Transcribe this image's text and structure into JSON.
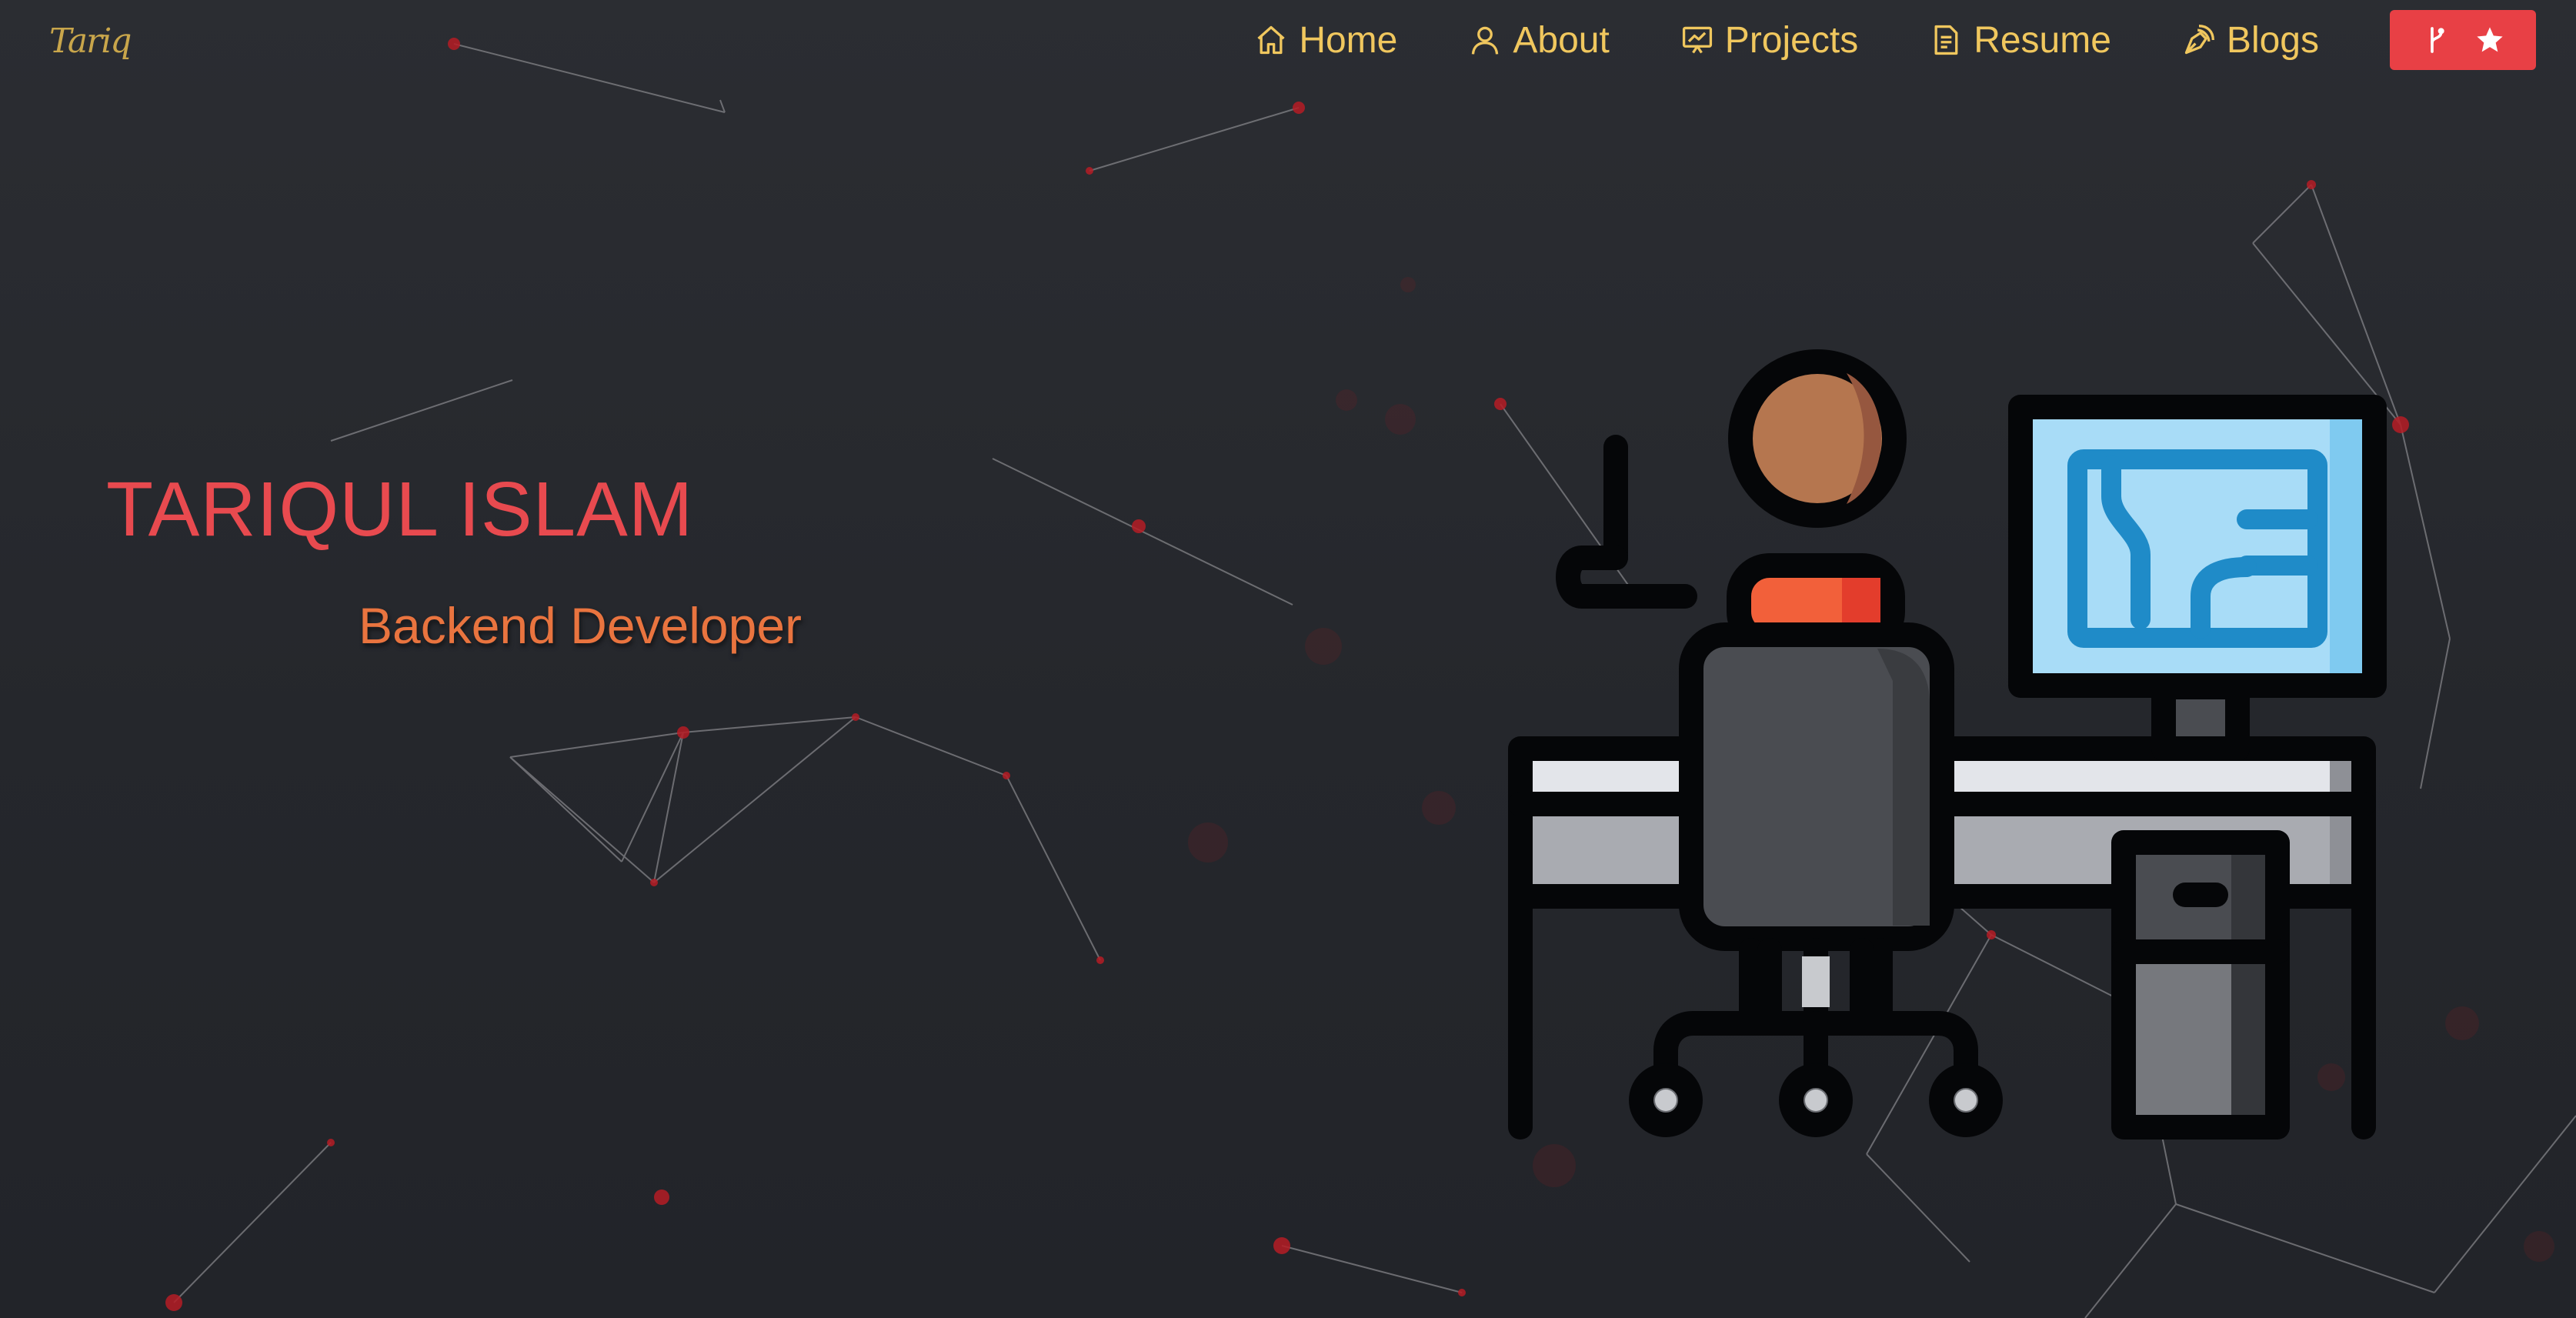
{
  "logo": {
    "text": "Tariq"
  },
  "nav": {
    "items": [
      {
        "label": "Home",
        "icon": "home-icon"
      },
      {
        "label": "About",
        "icon": "user-icon"
      },
      {
        "label": "Projects",
        "icon": "presentation-icon"
      },
      {
        "label": "Resume",
        "icon": "document-icon"
      },
      {
        "label": "Blogs",
        "icon": "pen-nib-icon"
      }
    ],
    "github_button": {
      "icons": [
        "fork-icon",
        "star-icon"
      ]
    }
  },
  "hero": {
    "name": "TARIQUL ISLAM",
    "role": "Backend Developer"
  },
  "colors": {
    "nav_text": "#f0c75e",
    "name": "#e84a4f",
    "role": "#e9743f",
    "button": "#e84045",
    "background": "#2a2c31",
    "particle": "#c0202a"
  }
}
